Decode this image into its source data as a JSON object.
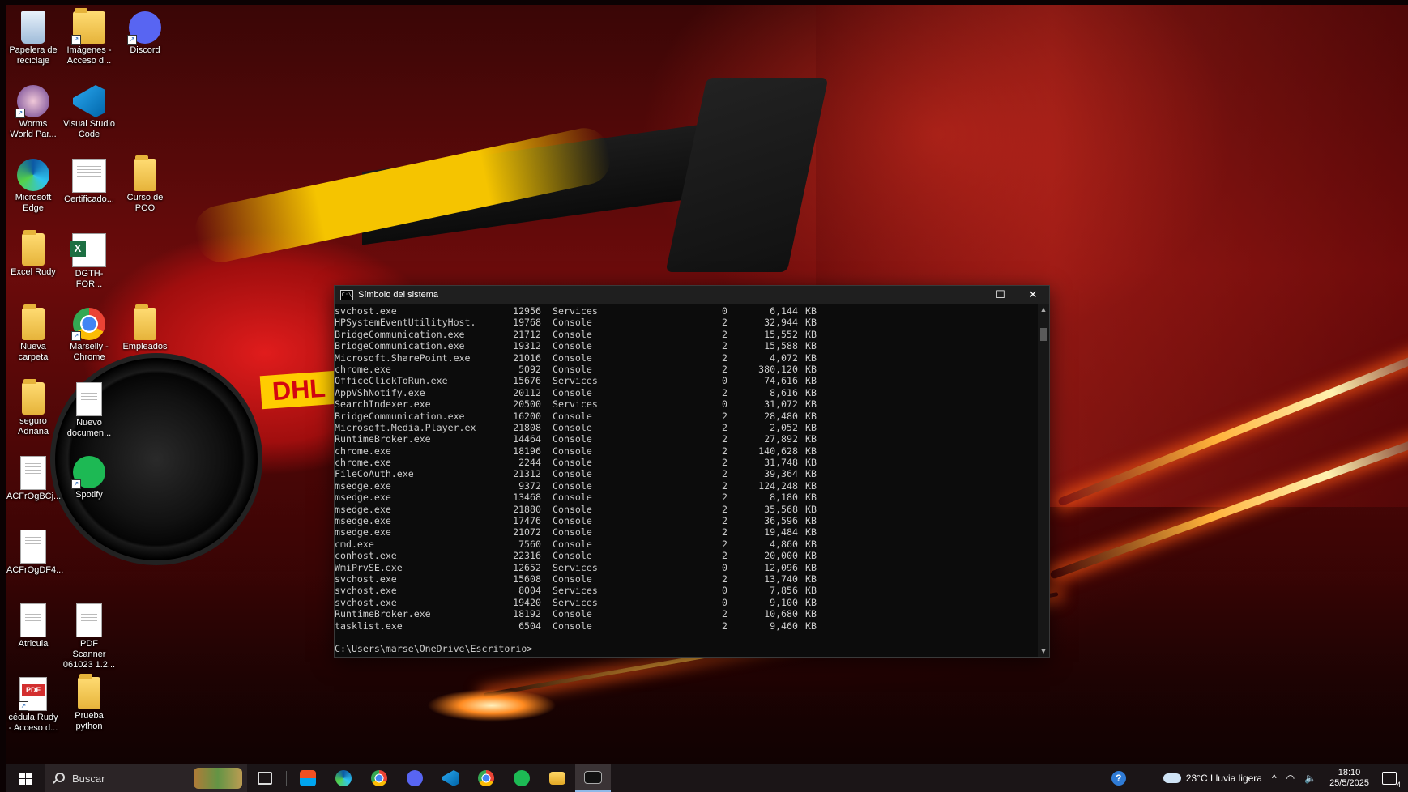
{
  "desktop": {
    "icons": [
      {
        "label": "Papelera de reciclaje",
        "icon": "recycle-bin-icon"
      },
      {
        "label": "Imágenes - Acceso d...",
        "icon": "pictures-folder-icon"
      },
      {
        "label": "Discord",
        "icon": "discord-icon"
      },
      {
        "label": "Worms World Par...",
        "icon": "worms-icon"
      },
      {
        "label": "Visual Studio Code",
        "icon": "vscode-icon"
      },
      {
        "label": "Microsoft Edge",
        "icon": "edge-icon"
      },
      {
        "label": "Certificado...",
        "icon": "document-icon"
      },
      {
        "label": "Curso de POO",
        "icon": "folder-icon"
      },
      {
        "label": "Excel Rudy",
        "icon": "folder-icon"
      },
      {
        "label": "DGTH-FOR...",
        "icon": "excel-icon"
      },
      {
        "label": "Nueva carpeta",
        "icon": "folder-icon"
      },
      {
        "label": "Marselly - Chrome",
        "icon": "chrome-icon"
      },
      {
        "label": "Empleados",
        "icon": "folder-icon"
      },
      {
        "label": "seguro Adriana",
        "icon": "folder-icon"
      },
      {
        "label": "Nuevo documen...",
        "icon": "text-document-icon"
      },
      {
        "label": "ACFrOgBCj...",
        "icon": "document-icon"
      },
      {
        "label": "Spotify",
        "icon": "spotify-icon"
      },
      {
        "label": "ACFrOgDF4...",
        "icon": "document-icon"
      },
      {
        "label": "Atricula",
        "icon": "document-icon"
      },
      {
        "label": "PDF Scanner 061023 1.2...",
        "icon": "document-icon"
      },
      {
        "label": "cédula Rudy - Acceso d...",
        "icon": "pdf-icon"
      },
      {
        "label": "Prueba python",
        "icon": "folder-icon"
      }
    ]
  },
  "console": {
    "title": "Símbolo del sistema",
    "rows": [
      {
        "name": "svchost.exe",
        "pid": "12956",
        "session": "Services",
        "num": "0",
        "mem": "6,144",
        "unit": "KB"
      },
      {
        "name": "HPSystemEventUtilityHost.",
        "pid": "19768",
        "session": "Console",
        "num": "2",
        "mem": "32,944",
        "unit": "KB"
      },
      {
        "name": "BridgeCommunication.exe",
        "pid": "21712",
        "session": "Console",
        "num": "2",
        "mem": "15,552",
        "unit": "KB"
      },
      {
        "name": "BridgeCommunication.exe",
        "pid": "19312",
        "session": "Console",
        "num": "2",
        "mem": "15,588",
        "unit": "KB"
      },
      {
        "name": "Microsoft.SharePoint.exe",
        "pid": "21016",
        "session": "Console",
        "num": "2",
        "mem": "4,072",
        "unit": "KB"
      },
      {
        "name": "chrome.exe",
        "pid": "5092",
        "session": "Console",
        "num": "2",
        "mem": "380,120",
        "unit": "KB"
      },
      {
        "name": "OfficeClickToRun.exe",
        "pid": "15676",
        "session": "Services",
        "num": "0",
        "mem": "74,616",
        "unit": "KB"
      },
      {
        "name": "AppVShNotify.exe",
        "pid": "20112",
        "session": "Console",
        "num": "2",
        "mem": "8,616",
        "unit": "KB"
      },
      {
        "name": "SearchIndexer.exe",
        "pid": "20500",
        "session": "Services",
        "num": "0",
        "mem": "31,072",
        "unit": "KB"
      },
      {
        "name": "BridgeCommunication.exe",
        "pid": "16200",
        "session": "Console",
        "num": "2",
        "mem": "28,480",
        "unit": "KB"
      },
      {
        "name": "Microsoft.Media.Player.ex",
        "pid": "21808",
        "session": "Console",
        "num": "2",
        "mem": "2,052",
        "unit": "KB"
      },
      {
        "name": "RuntimeBroker.exe",
        "pid": "14464",
        "session": "Console",
        "num": "2",
        "mem": "27,892",
        "unit": "KB"
      },
      {
        "name": "chrome.exe",
        "pid": "18196",
        "session": "Console",
        "num": "2",
        "mem": "140,628",
        "unit": "KB"
      },
      {
        "name": "chrome.exe",
        "pid": "2244",
        "session": "Console",
        "num": "2",
        "mem": "31,748",
        "unit": "KB"
      },
      {
        "name": "FileCoAuth.exe",
        "pid": "21312",
        "session": "Console",
        "num": "2",
        "mem": "39,364",
        "unit": "KB"
      },
      {
        "name": "msedge.exe",
        "pid": "9372",
        "session": "Console",
        "num": "2",
        "mem": "124,248",
        "unit": "KB"
      },
      {
        "name": "msedge.exe",
        "pid": "13468",
        "session": "Console",
        "num": "2",
        "mem": "8,180",
        "unit": "KB"
      },
      {
        "name": "msedge.exe",
        "pid": "21880",
        "session": "Console",
        "num": "2",
        "mem": "35,568",
        "unit": "KB"
      },
      {
        "name": "msedge.exe",
        "pid": "17476",
        "session": "Console",
        "num": "2",
        "mem": "36,596",
        "unit": "KB"
      },
      {
        "name": "msedge.exe",
        "pid": "21072",
        "session": "Console",
        "num": "2",
        "mem": "19,484",
        "unit": "KB"
      },
      {
        "name": "cmd.exe",
        "pid": "7560",
        "session": "Console",
        "num": "2",
        "mem": "4,860",
        "unit": "KB"
      },
      {
        "name": "conhost.exe",
        "pid": "22316",
        "session": "Console",
        "num": "2",
        "mem": "20,000",
        "unit": "KB"
      },
      {
        "name": "WmiPrvSE.exe",
        "pid": "12652",
        "session": "Services",
        "num": "0",
        "mem": "12,096",
        "unit": "KB"
      },
      {
        "name": "svchost.exe",
        "pid": "15608",
        "session": "Console",
        "num": "2",
        "mem": "13,740",
        "unit": "KB"
      },
      {
        "name": "svchost.exe",
        "pid": "8004",
        "session": "Services",
        "num": "0",
        "mem": "7,856",
        "unit": "KB"
      },
      {
        "name": "svchost.exe",
        "pid": "19420",
        "session": "Services",
        "num": "0",
        "mem": "9,100",
        "unit": "KB"
      },
      {
        "name": "RuntimeBroker.exe",
        "pid": "18192",
        "session": "Console",
        "num": "2",
        "mem": "10,680",
        "unit": "KB"
      },
      {
        "name": "tasklist.exe",
        "pid": "6504",
        "session": "Console",
        "num": "2",
        "mem": "9,460",
        "unit": "KB"
      }
    ],
    "prompt": "C:\\Users\\marse\\OneDrive\\Escritorio>"
  },
  "taskbar": {
    "search_placeholder": "Buscar",
    "apps": [
      "task-view-icon",
      "store-icon",
      "edge-icon",
      "chrome-icon",
      "discord-icon",
      "vscode-icon",
      "chrome-icon",
      "spotify-icon",
      "file-explorer-icon",
      "terminal-icon"
    ],
    "weather": "23°C  Lluvia ligera",
    "time": "18:10",
    "date": "25/5/2025",
    "notification_count": "4"
  },
  "colors": {
    "console_bg": "#0c0c0c",
    "console_text": "#cccccc",
    "taskbar_bg": "#1b1517"
  }
}
